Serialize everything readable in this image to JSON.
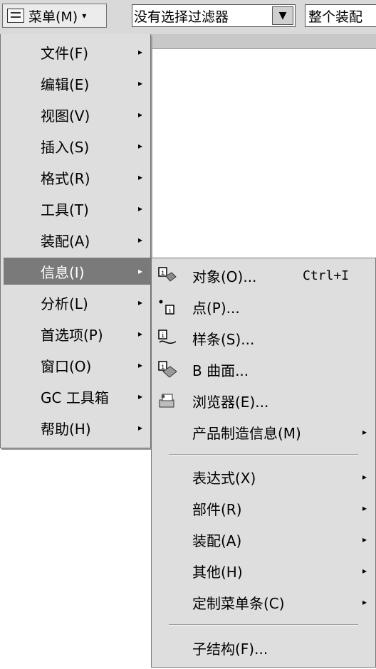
{
  "toolbar": {
    "menu_label": "菜单(M)",
    "filter_text": "没有选择过滤器",
    "scope_text": "整个装配"
  },
  "main_menu": {
    "items": [
      {
        "label": "文件(F)"
      },
      {
        "label": "编辑(E)"
      },
      {
        "label": "视图(V)"
      },
      {
        "label": "插入(S)"
      },
      {
        "label": "格式(R)"
      },
      {
        "label": "工具(T)"
      },
      {
        "label": "装配(A)"
      },
      {
        "label": "信息(I)",
        "active": true
      },
      {
        "label": "分析(L)"
      },
      {
        "label": "首选项(P)"
      },
      {
        "label": "窗口(O)"
      },
      {
        "label": "GC 工具箱"
      },
      {
        "label": "帮助(H)"
      }
    ]
  },
  "info_submenu": {
    "items": [
      {
        "icon": "object-info-icon",
        "label": "对象(O)...",
        "shortcut": "Ctrl+I"
      },
      {
        "icon": "point-info-icon",
        "label": "点(P)..."
      },
      {
        "icon": "spline-info-icon",
        "label": "样条(S)..."
      },
      {
        "icon": "surface-info-icon",
        "label": "B 曲面..."
      },
      {
        "icon": "browser-info-icon",
        "label": "浏览器(E)..."
      },
      {
        "label": "产品制造信息(M)",
        "has_submenu": true
      },
      {
        "label": "表达式(X)",
        "has_submenu": true
      },
      {
        "label": "部件(R)",
        "has_submenu": true
      },
      {
        "label": "装配(A)",
        "has_submenu": true
      },
      {
        "label": "其他(H)",
        "has_submenu": true
      },
      {
        "label": "定制菜单条(C)",
        "has_submenu": true
      },
      {
        "label": "子结构(F)..."
      }
    ]
  },
  "colors": {
    "menu_bg": "#dedede",
    "highlight_bg": "#7a7a7a",
    "highlight_fg": "#ffffff"
  }
}
